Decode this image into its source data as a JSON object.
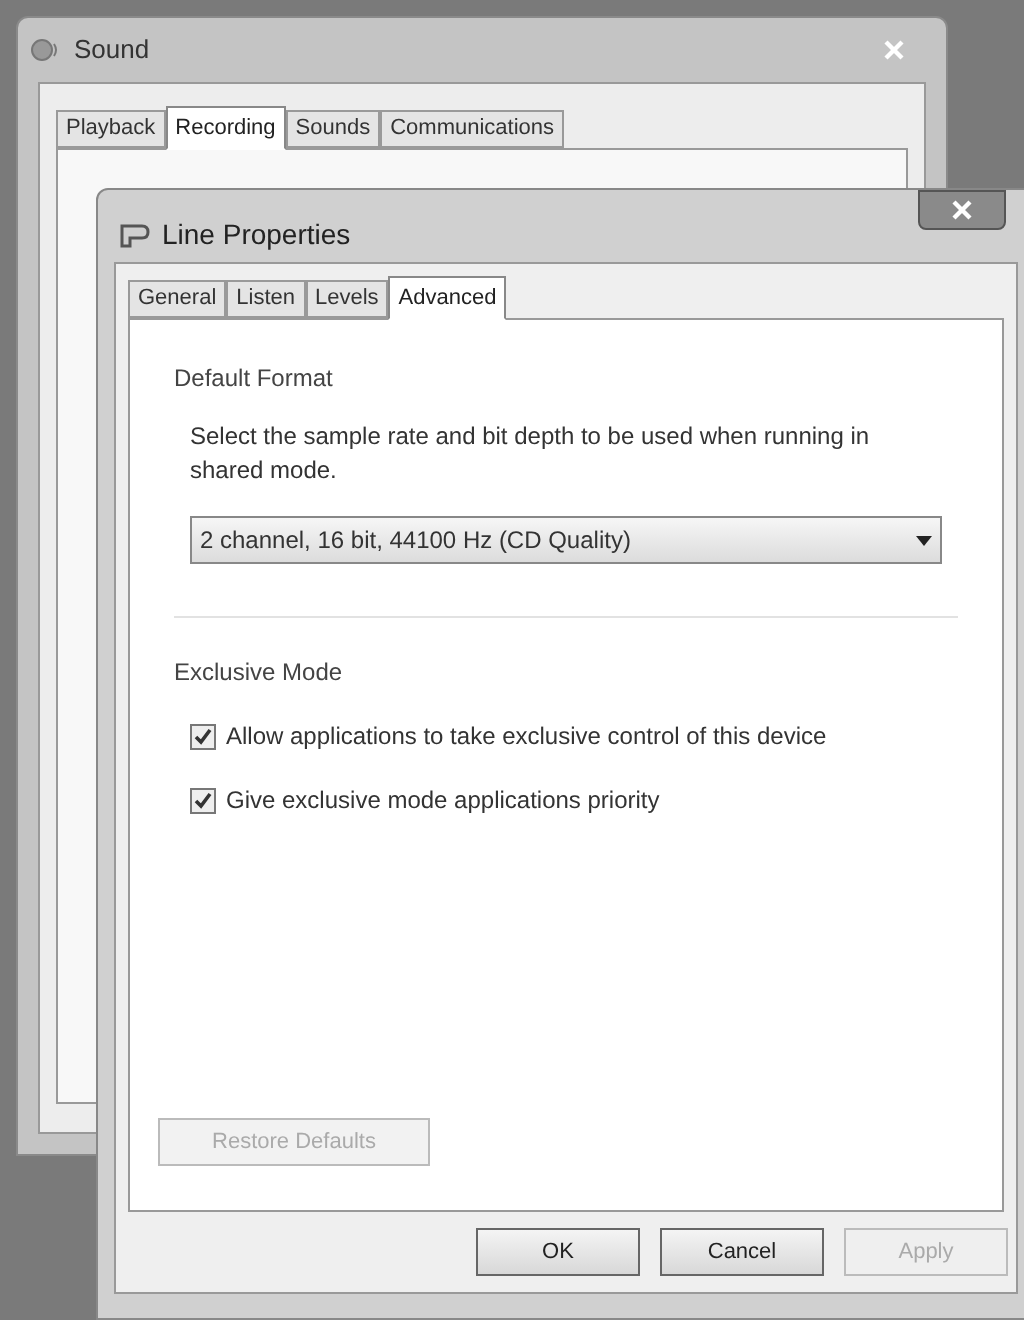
{
  "sound_window": {
    "title": "Sound",
    "tabs": [
      {
        "label": "Playback",
        "selected": false
      },
      {
        "label": "Recording",
        "selected": true
      },
      {
        "label": "Sounds",
        "selected": false
      },
      {
        "label": "Communications",
        "selected": false
      }
    ]
  },
  "dialog": {
    "title": "Line Properties",
    "tabs": [
      {
        "label": "General",
        "selected": false
      },
      {
        "label": "Listen",
        "selected": false
      },
      {
        "label": "Levels",
        "selected": false
      },
      {
        "label": "Advanced",
        "selected": true
      }
    ],
    "default_format": {
      "heading": "Default Format",
      "description": "Select the sample rate and bit depth to be used when running in shared mode.",
      "format": "2 channel, 16 bit, 44100 Hz (CD Quality)"
    },
    "exclusive_mode": {
      "heading": "Exclusive Mode",
      "options": [
        {
          "label": "Allow applications to take exclusive control of this device",
          "checked": true
        },
        {
          "label": "Give exclusive mode applications priority",
          "checked": true
        }
      ]
    },
    "restore_button": {
      "label": "Restore Defaults",
      "disabled": true
    },
    "buttons": [
      {
        "label": "OK",
        "disabled": false
      },
      {
        "label": "Cancel",
        "disabled": false
      },
      {
        "label": "Apply",
        "disabled": true
      }
    ]
  }
}
